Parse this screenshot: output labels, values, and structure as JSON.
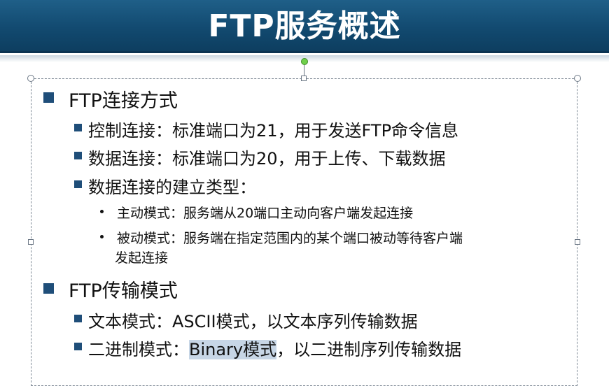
{
  "slide": {
    "title": "FTP服务概述",
    "sections": [
      {
        "heading": "FTP连接方式",
        "items": [
          {
            "text": "控制连接：标准端口为21，用于发送FTP命令信息"
          },
          {
            "text": "数据连接：标准端口为20，用于上传、下载数据"
          },
          {
            "text": "数据连接的建立类型："
          }
        ],
        "subitems": [
          {
            "text": "主动模式：服务端从20端口主动向客户端发起连接"
          },
          {
            "text": "被动模式：服务端在指定范围内的某个端口被动等待客户端",
            "cont": "发起连接"
          }
        ]
      },
      {
        "heading": "FTP传输模式",
        "items": [
          {
            "text": "文本模式：ASCII模式，以文本序列传输数据"
          },
          {
            "prefix": "二进制模式：",
            "highlight": "Binary模式",
            "suffix": "，以二进制序列传输数据"
          }
        ]
      }
    ]
  },
  "colors": {
    "title_bar": "#124a70",
    "bullet": "#1f4e79",
    "selection_highlight": "#c7d6e6",
    "rotate_handle": "#6fd04a"
  }
}
